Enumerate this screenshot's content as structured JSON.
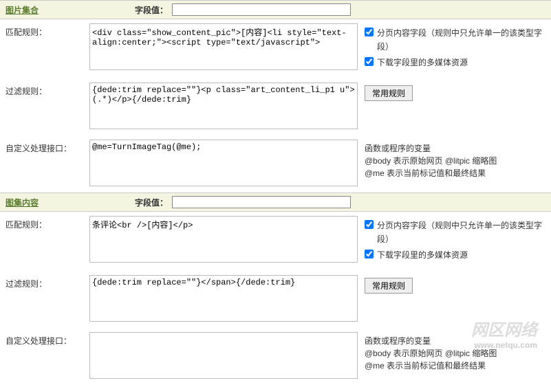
{
  "sections": [
    {
      "title": "图片集合",
      "field_label": "字段值：",
      "field_value": "",
      "match": {
        "label": "匹配规则：",
        "value": "<div class=\"show_content_pic\">[内容]<li style=\"text-align:center;\"><script type=\"text/javascript\">",
        "cb1": "分页内容字段（规则中只允许单一的该类型字段）",
        "cb2": "下载字段里的多媒体资源"
      },
      "filter": {
        "label": "过滤规则：",
        "value": "{dede:trim replace=\"\"}<p class=\"art_content_li_p1 u\">(.*)</p>{/dede:trim}",
        "btn": "常用规则"
      },
      "custom": {
        "label": "自定义处理接口：",
        "value": "@me=TurnImageTag(@me);",
        "help1": "函数或程序的变量",
        "help2": "@body 表示原始网页 @litpic 缩略图",
        "help3": "@me 表示当前标记值和最终结果"
      }
    },
    {
      "title": "图集内容",
      "field_label": "字段值：",
      "field_value": "",
      "match": {
        "label": "匹配规则：",
        "value": "条评论<br />[内容]</p>",
        "cb1": "分页内容字段（规则中只允许单一的该类型字段）",
        "cb2": "下载字段里的多媒体资源"
      },
      "filter": {
        "label": "过滤规则：",
        "value": "{dede:trim replace=\"\"}</span>{/dede:trim}",
        "btn": "常用规则"
      },
      "custom": {
        "label": "自定义处理接口：",
        "value": "",
        "help1": "函数或程序的变量",
        "help2": "@body 表示原始网页 @litpic 缩略图",
        "help3": "@me 表示当前标记值和最终结果"
      }
    }
  ],
  "watermark": {
    "main": "网区网络",
    "sub": "www.netqu.com"
  }
}
